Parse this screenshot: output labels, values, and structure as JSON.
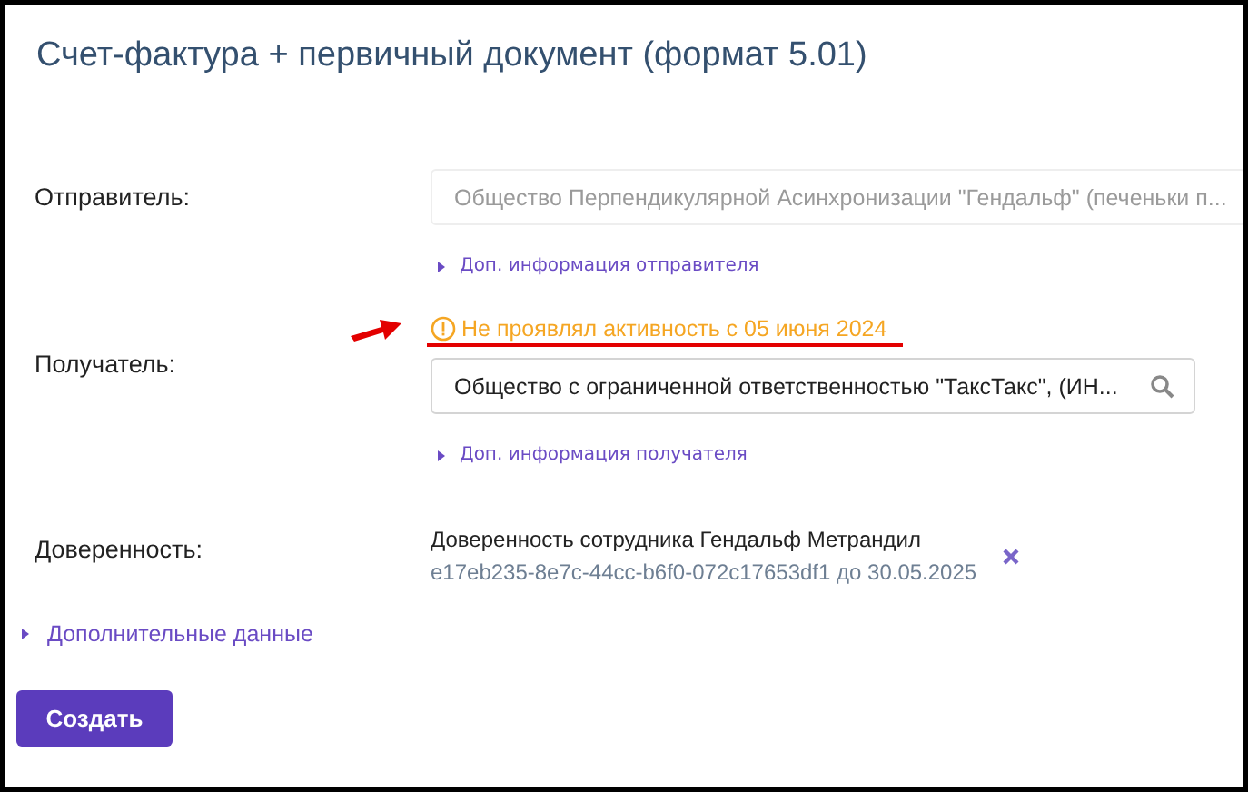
{
  "title": "Счет-фактура + первичный документ (формат 5.01)",
  "sender": {
    "label": "Отправитель:",
    "value": "Общество Перпендикулярной Асинхронизации \"Гендальф\" (печеньки п...",
    "disabled": true,
    "more_link": "Доп. информация отправителя"
  },
  "recipient": {
    "label": "Получатель:",
    "warning": "Не проявлял активность с 05 июня 2024",
    "value": "Общество с ограниченной ответственностью \"ТаксТакс\", (ИН...",
    "more_link": "Доп. информация получателя"
  },
  "power_of_attorney": {
    "label": "Доверенность:",
    "name": "Доверенность сотрудника Гендальф Метрандил",
    "details": "e17eb235-8e7c-44cc-b6f0-072c17653df1 до 30.05.2025"
  },
  "additional_data": {
    "label": "Дополнительные данные",
    "expanded": false
  },
  "submit_button": "Создать"
}
